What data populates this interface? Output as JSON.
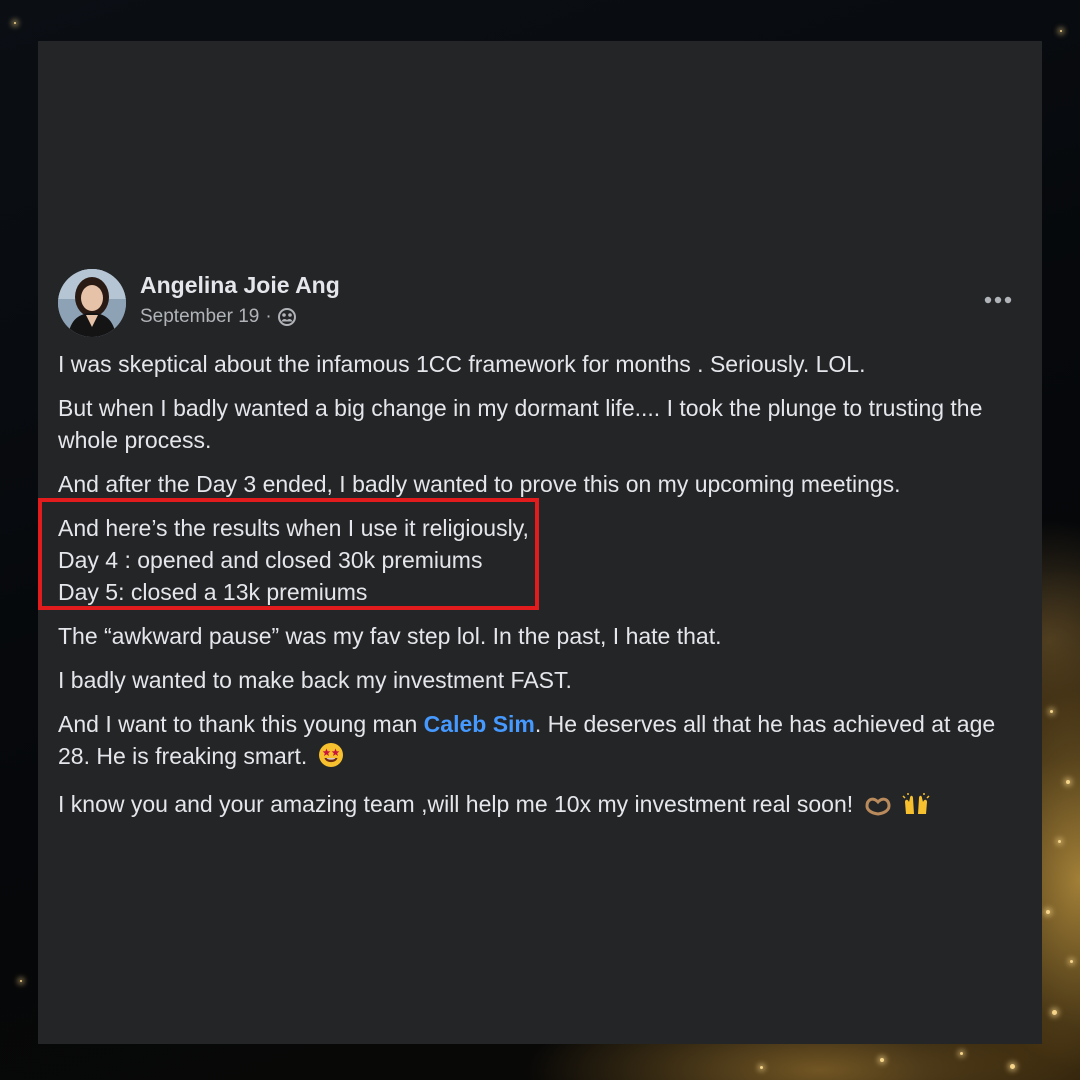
{
  "post": {
    "author": "Angelina Joie Ang",
    "date": "September 19",
    "meta_separator": "·",
    "audience_icon": "friends-icon",
    "more_icon": "more-horizontal-icon",
    "paragraphs": {
      "p1": "I was skeptical about the infamous 1CC framework for months . Seriously. LOL.",
      "p2": "But when I badly wanted a big change in my dormant life.... I took the plunge to trusting the whole process.",
      "p3": "And after the Day 3 ended, I badly wanted to prove this on my upcoming meetings.",
      "highlight": {
        "line1": "And here’s the results when I use it religiously,",
        "line2": "Day 4 : opened and closed 30k premiums",
        "line3": "Day 5: closed a 13k premiums"
      },
      "p5": "The “awkward pause” was my fav step lol. In the past, I hate that.",
      "p6": "I badly wanted to make back my investment FAST.",
      "p7_before": "And I want to thank this young man ",
      "p7_mention": "Caleb Sim",
      "p7_after": ". He deserves all that he has achieved at age 28. He is freaking smart.",
      "p7_emoji": "star-struck-emoji",
      "p8": "I know you and your amazing team ,will help me 10x my investment real soon!",
      "p8_emojis": [
        "heart-hands-emoji",
        "raising-hands-emoji"
      ]
    },
    "colors": {
      "card_bg": "#242526",
      "text": "#e4e6eb",
      "secondary_text": "#b0b3b8",
      "mention": "#4599ff",
      "highlight_border": "#e21c1c"
    }
  }
}
